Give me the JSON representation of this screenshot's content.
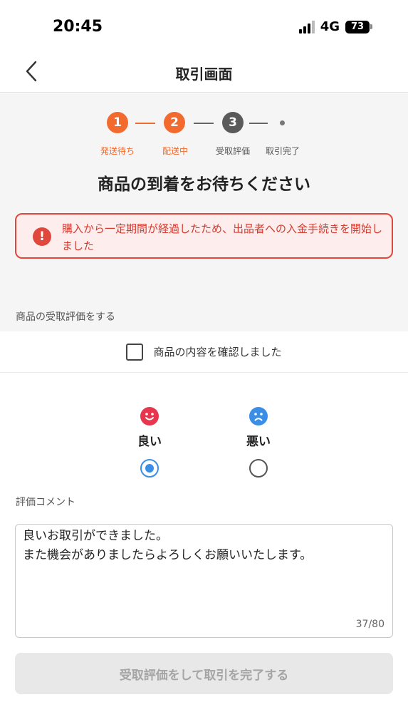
{
  "status_bar": {
    "time": "20:45",
    "network": "4G",
    "battery": "73"
  },
  "header": {
    "title": "取引画面",
    "back_icon": "chevron-left-icon"
  },
  "progress": {
    "steps": [
      {
        "number": "1",
        "label": "発送待ち",
        "state": "done"
      },
      {
        "number": "2",
        "label": "配送中",
        "state": "current"
      },
      {
        "number": "3",
        "label": "受取評価",
        "state": "pending"
      },
      {
        "number": "",
        "label": "取引完了",
        "state": "pending"
      }
    ],
    "heading": "商品の到着をお待ちください"
  },
  "alert": {
    "icon": "exclamation-icon",
    "text": "購入から一定期間が経過したため、出品者への入金手続きを開始しました"
  },
  "review": {
    "section_title": "商品の受取評価をする",
    "confirm_label": "商品の内容を確認しました",
    "confirm_checked": false,
    "options": [
      {
        "label": "良い",
        "icon": "smile-face-icon",
        "selected": true
      },
      {
        "label": "悪い",
        "icon": "sad-face-icon",
        "selected": false
      }
    ],
    "comment_label": "評価コメント",
    "comment_value": "良いお取引ができました。\nまた機会がありましたらよろしくお願いいたします。",
    "char_count": "37/80",
    "submit_label": "受取評価をして取引を完了する"
  },
  "colors": {
    "accent": "#f26a2e",
    "inactive_step": "#5a5a5a",
    "alert_red": "#e0483d",
    "good": "#e8364f",
    "bad": "#3a8ee6",
    "radio_selected": "#3a8ee6"
  }
}
